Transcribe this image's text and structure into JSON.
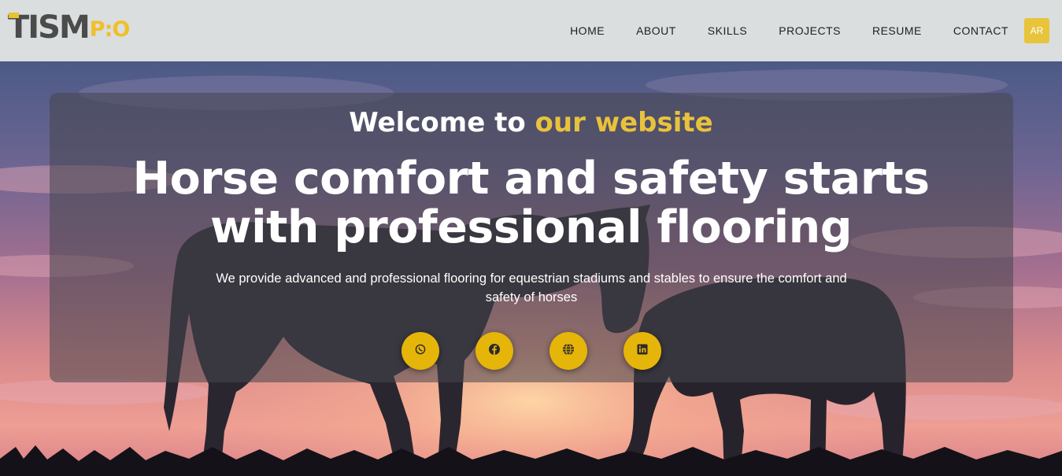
{
  "brand": {
    "logo_main": "TISM",
    "logo_suffix": "P:O",
    "accent_color": "#e8c43a"
  },
  "nav": {
    "items": [
      {
        "label": "HOME"
      },
      {
        "label": "ABOUT"
      },
      {
        "label": "SKILLS"
      },
      {
        "label": "PROJECTS"
      },
      {
        "label": "RESUME"
      },
      {
        "label": "CONTACT"
      }
    ],
    "language_button": "AR"
  },
  "hero": {
    "welcome_prefix": "Welcome to ",
    "welcome_accent": "our website",
    "headline": "Horse comfort and safety starts with professional flooring",
    "subtext": "We provide advanced and professional flooring for equestrian stadiums and stables to ensure the comfort and safety of horses",
    "background": "sunset-sky-with-horse-silhouettes",
    "social": [
      {
        "icon": "whatsapp-icon"
      },
      {
        "icon": "facebook-icon"
      },
      {
        "icon": "globe-icon"
      },
      {
        "icon": "linkedin-icon"
      }
    ]
  }
}
